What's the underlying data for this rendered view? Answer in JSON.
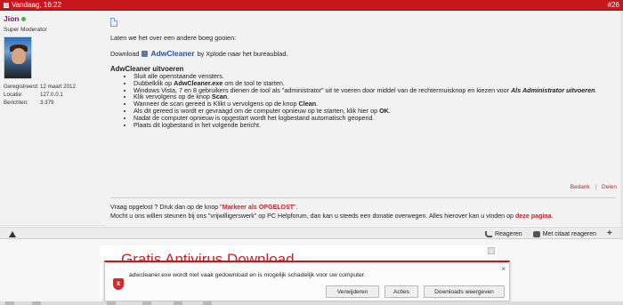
{
  "post": {
    "date": "Vandaag, 16:22",
    "number": "#26"
  },
  "user": {
    "name": "Jion",
    "title": "Super Moderator",
    "stats": [
      {
        "key": "Geregistreerd:",
        "value": "12 maart 2012"
      },
      {
        "key": "Locatie:",
        "value": "127.0.0.1"
      },
      {
        "key": "Berichten:",
        "value": "3.379"
      }
    ]
  },
  "message": {
    "intro": "Laten we het over een andere boeg gooien:",
    "download_prefix": "Download",
    "tool_name": "AdwCleaner",
    "download_suffix": "by Xplode naar het bureaublad.",
    "section_title": "AdwCleaner uitvoeren",
    "steps": [
      {
        "t1": "Sluit alle openstaande vensters.",
        "b": "",
        "t2": ""
      },
      {
        "t1": "Dubbelklik op ",
        "b": "AdwCleaner.exe",
        "t2": " om de tool te starten."
      },
      {
        "t1": "Windows Vista, 7 en 8 gebruikers dienen de tool als \"administrator\" uit te voeren door middel van de rechtermuisknop en kiezen voor ",
        "bi": "Als Administrator uitvoeren",
        "t2": "."
      },
      {
        "t1": "Klik vervolgens op de knop ",
        "b": "Scan",
        "t2": "."
      },
      {
        "t1": "Wanneer de scan gereed is Klikt u vervolgens op de knop ",
        "b": "Clean",
        "t2": "."
      },
      {
        "t1": "Als dit gereed is wordt er gevraagd om de computer opnieuw op te starten, klik hier op ",
        "b": "OK",
        "t2": "."
      },
      {
        "t1": "Nadat de computer opnieuw is opgestart wordt het logbestand automatisch geopend.",
        "b": "",
        "t2": ""
      },
      {
        "t1": "Plaats dit logbestand in het volgende bericht.",
        "b": "",
        "t2": ""
      }
    ]
  },
  "post_links": {
    "thanks": "Bedank",
    "separator": "|",
    "share": "Delen"
  },
  "signature": {
    "line1_prefix": "Vraag opgelost ? Druk dan op de knop \"",
    "line1_highlight": "Markeer als OPGELOST",
    "line1_suffix": "\".",
    "line2_prefix": "Mocht u ons willen steunen bij ons \"vrijwilligerswerk\" op PC Helpforum, dan kan u steeds een donatie overwegen. Alles hierover kan u vinden op",
    "line2_link": "deze pagina",
    "line2_suffix": "."
  },
  "footer": {
    "reply": "Reageren",
    "quote_reply": "Met citaat reageren"
  },
  "ad": {
    "title": "Gratis Antivirus Download"
  },
  "notification": {
    "message": "adwcleaner.exe wordt niet vaak gedownload en is mogelijk schadelijk voor uw computer.",
    "close": "×",
    "delete_label": "Verwijderen",
    "actions_label": "Acties",
    "view_downloads_label": "Downloads weergeven",
    "shield_glyph": "x"
  },
  "colors": {
    "header_red": "#c8161d",
    "username_purple": "#8b0f6b",
    "link_blue": "#2a4fa5",
    "signature_red": "#c0262d"
  }
}
